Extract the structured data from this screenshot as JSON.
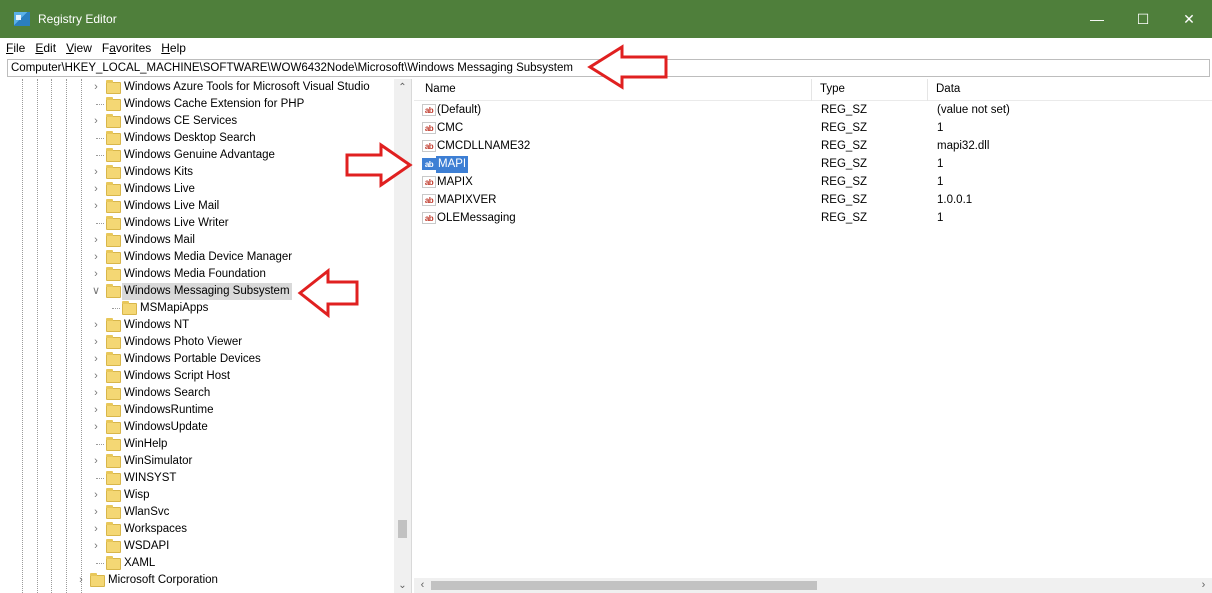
{
  "window": {
    "title": "Registry Editor",
    "controls": {
      "minimize": "—",
      "maximize": "☐",
      "close": "✕"
    }
  },
  "menu": [
    {
      "underline": "F",
      "rest": "ile"
    },
    {
      "underline": "E",
      "rest": "dit"
    },
    {
      "underline": "V",
      "rest": "iew"
    },
    {
      "pre": "F",
      "underline": "a",
      "rest": "vorites"
    },
    {
      "underline": "H",
      "rest": "elp"
    }
  ],
  "address": "Computer\\HKEY_LOCAL_MACHINE\\SOFTWARE\\WOW6432Node\\Microsoft\\Windows Messaging Subsystem",
  "tree": [
    {
      "label": "Windows Azure Tools for Microsoft Visual Studio",
      "expander": "collapsed",
      "level": 0
    },
    {
      "label": "Windows Cache Extension for PHP",
      "expander": "none",
      "level": 0
    },
    {
      "label": "Windows CE Services",
      "expander": "collapsed",
      "level": 0
    },
    {
      "label": "Windows Desktop Search",
      "expander": "none",
      "level": 0
    },
    {
      "label": "Windows Genuine Advantage",
      "expander": "none",
      "level": 0
    },
    {
      "label": "Windows Kits",
      "expander": "collapsed",
      "level": 0
    },
    {
      "label": "Windows Live",
      "expander": "collapsed",
      "level": 0
    },
    {
      "label": "Windows Live Mail",
      "expander": "collapsed",
      "level": 0
    },
    {
      "label": "Windows Live Writer",
      "expander": "none",
      "level": 0
    },
    {
      "label": "Windows Mail",
      "expander": "collapsed",
      "level": 0
    },
    {
      "label": "Windows Media Device Manager",
      "expander": "collapsed",
      "level": 0
    },
    {
      "label": "Windows Media Foundation",
      "expander": "collapsed",
      "level": 0
    },
    {
      "label": "Windows Messaging Subsystem",
      "expander": "expanded",
      "level": 0,
      "selected": true
    },
    {
      "label": "MSMapiApps",
      "expander": "none",
      "level": 1
    },
    {
      "label": "Windows NT",
      "expander": "collapsed",
      "level": 0
    },
    {
      "label": "Windows Photo Viewer",
      "expander": "collapsed",
      "level": 0
    },
    {
      "label": "Windows Portable Devices",
      "expander": "collapsed",
      "level": 0
    },
    {
      "label": "Windows Script Host",
      "expander": "collapsed",
      "level": 0
    },
    {
      "label": "Windows Search",
      "expander": "collapsed",
      "level": 0
    },
    {
      "label": "WindowsRuntime",
      "expander": "collapsed",
      "level": 0
    },
    {
      "label": "WindowsUpdate",
      "expander": "collapsed",
      "level": 0
    },
    {
      "label": "WinHelp",
      "expander": "none",
      "level": 0
    },
    {
      "label": "WinSimulator",
      "expander": "collapsed",
      "level": 0
    },
    {
      "label": "WINSYST",
      "expander": "none",
      "level": 0
    },
    {
      "label": "Wisp",
      "expander": "collapsed",
      "level": 0
    },
    {
      "label": "WlanSvc",
      "expander": "collapsed",
      "level": 0
    },
    {
      "label": "Workspaces",
      "expander": "collapsed",
      "level": 0
    },
    {
      "label": "WSDAPI",
      "expander": "collapsed",
      "level": 0
    },
    {
      "label": "XAML",
      "expander": "none",
      "level": 0
    },
    {
      "label": "Microsoft Corporation",
      "expander": "collapsed",
      "level": -1
    }
  ],
  "list": {
    "columns": [
      "Name",
      "Type",
      "Data"
    ],
    "rows": [
      {
        "name": "(Default)",
        "type": "REG_SZ",
        "data": "(value not set)"
      },
      {
        "name": "CMC",
        "type": "REG_SZ",
        "data": "1"
      },
      {
        "name": "CMCDLLNAME32",
        "type": "REG_SZ",
        "data": "mapi32.dll"
      },
      {
        "name": "MAPI",
        "type": "REG_SZ",
        "data": "1",
        "selected": true
      },
      {
        "name": "MAPIX",
        "type": "REG_SZ",
        "data": "1"
      },
      {
        "name": "MAPIXVER",
        "type": "REG_SZ",
        "data": "1.0.0.1"
      },
      {
        "name": "OLEMessaging",
        "type": "REG_SZ",
        "data": "1"
      }
    ]
  },
  "value_icon": "ab",
  "colors": {
    "titlebar": "#4f7f3b",
    "selection": "#3d7fd4",
    "annotation_arrow": "#e02020"
  }
}
